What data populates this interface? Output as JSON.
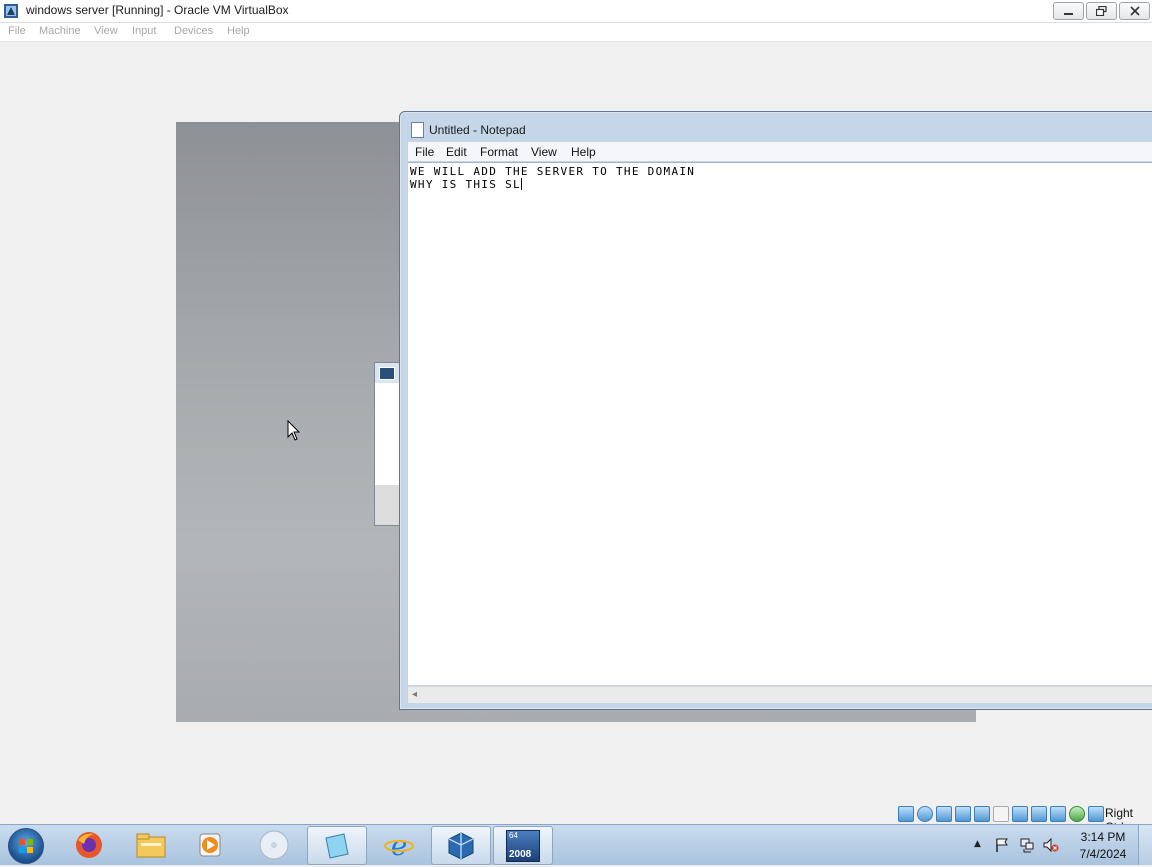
{
  "vbox": {
    "title": "windows server [Running] - Oracle VM VirtualBox",
    "menu": [
      "File",
      "Machine",
      "View",
      "Input",
      "Devices",
      "Help"
    ],
    "host_key_label": "Right Ctrl",
    "status_icons": [
      "hard-disk-icon",
      "optical-drive-icon",
      "audio-icon",
      "network-icon",
      "usb-icon",
      "shared-folder-icon",
      "display-icon",
      "video-capture-icon",
      "cpu-icon",
      "mouse-integration-icon",
      "keyboard-icon"
    ]
  },
  "notepad": {
    "title": "Untitled - Notepad",
    "menu": [
      "File",
      "Edit",
      "Format",
      "View",
      "Help"
    ],
    "lines": [
      "WE WILL ADD THE SERVER TO THE DOMAIN",
      "WHY IS THIS SL"
    ]
  },
  "taskbar": {
    "apps": [
      "firefox-icon",
      "file-explorer-icon",
      "media-player-icon",
      "disc-icon",
      "notepad-icon",
      "internet-explorer-icon",
      "virtualbox-icon",
      "windows-server-2008-icon"
    ],
    "vm_badge_top": "64",
    "vm_badge_bottom": "2008",
    "time": "3:14 PM",
    "date": "7/4/2024"
  },
  "colors": {
    "taskbar": "#b9d0e8",
    "notepad_frame": "#c5d6e8",
    "desktop": "#a3a7ab"
  }
}
